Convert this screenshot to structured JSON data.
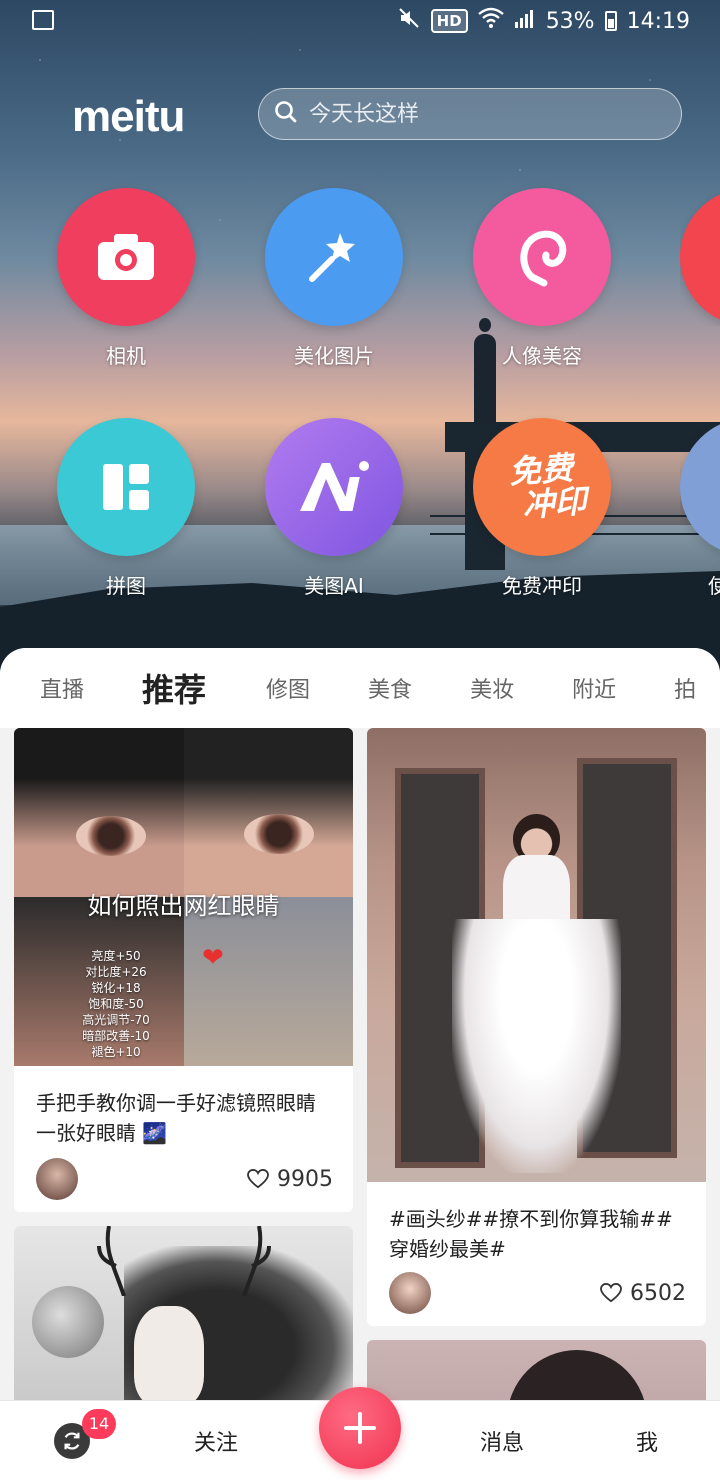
{
  "status_bar": {
    "battery": "53%",
    "time": "14:19",
    "hd": "HD",
    "icons": [
      "gallery-icon",
      "mute-icon",
      "wifi-icon",
      "signal-icon",
      "battery-icon"
    ]
  },
  "header": {
    "logo": "meitu",
    "search_placeholder": "今天长这样"
  },
  "features": [
    {
      "label": "相机",
      "icon": "camera-icon",
      "color": "#f03e5f"
    },
    {
      "label": "美化图片",
      "icon": "magic-wand-icon",
      "color": "#4b9cf0"
    },
    {
      "label": "人像美容",
      "icon": "portrait-icon",
      "color": "#f45b9e"
    },
    {
      "label": "拼图",
      "icon": "collage-icon",
      "color": "#3bc9d6"
    },
    {
      "label": "美图AI",
      "icon": "ai-icon",
      "color": "#9d63e8"
    },
    {
      "label": "免费冲印",
      "icon": "print-icon",
      "color": "#f57a45",
      "icon_text": "免费\n冲印"
    },
    {
      "label": "使",
      "icon": "partial-icon",
      "color": "#7f9fd6"
    }
  ],
  "tabs": [
    "直播",
    "推荐",
    "修图",
    "美食",
    "美妆",
    "附近",
    "拍"
  ],
  "active_tab": "推荐",
  "cards": [
    {
      "caption": "手把手教你调一手好滤镜照眼睛一张好眼睛 🌌",
      "likes": "9905",
      "overlay_title": "如何照出网红眼睛",
      "adjustments": [
        "亮度+50",
        "对比度+26",
        "锐化+18",
        "饱和度-50",
        "高光调节-70",
        "暗部改善-10",
        "褪色+10"
      ]
    },
    {
      "caption": "#画头纱##撩不到你算我输##穿婚纱最美#",
      "likes": "6502"
    }
  ],
  "bottom_nav": {
    "badge": "14",
    "follow": "关注",
    "messages": "消息",
    "me": "我"
  }
}
